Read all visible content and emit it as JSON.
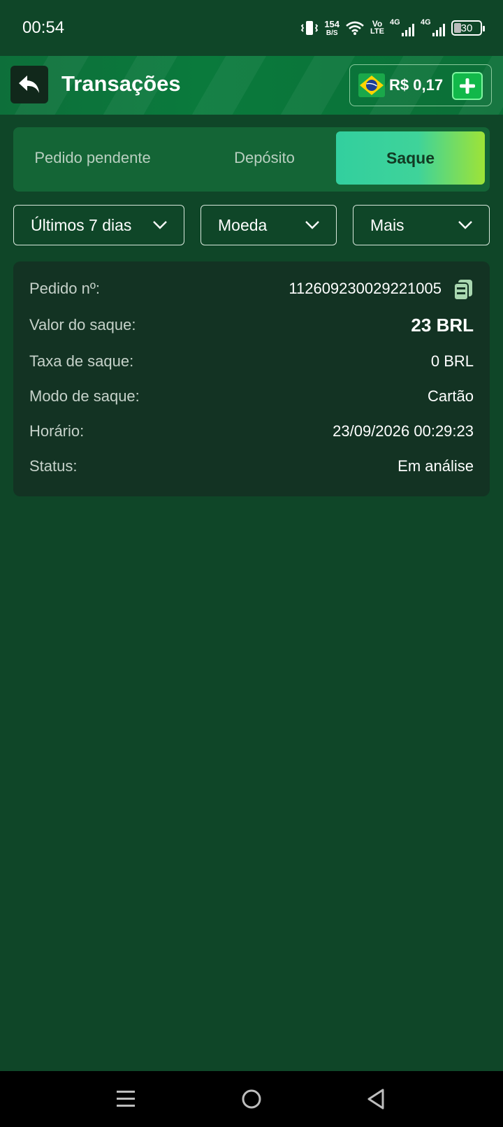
{
  "status_bar": {
    "time": "00:54",
    "net_speed_value": "154",
    "net_speed_unit": "B/S",
    "volte_top": "Vo",
    "volte_bottom": "LTE",
    "signal1_label": "4G",
    "signal2_label": "4G",
    "battery": "30",
    "icons": [
      "vibrate-icon",
      "wifi-icon",
      "signal-icon",
      "signal-icon",
      "battery-icon"
    ]
  },
  "header": {
    "title": "Transações",
    "balance": "R$ 0,17",
    "back_icon": "back-arrow-icon",
    "flag_icon": "brazil-flag-icon",
    "add_icon": "plus-icon",
    "colors": {
      "header_bg": "#0a7a3c",
      "add_button": "#12b84a"
    }
  },
  "tabs": [
    {
      "label": "Pedido pendente",
      "active": false
    },
    {
      "label": "Depósito",
      "active": false
    },
    {
      "label": "Saque",
      "active": true
    }
  ],
  "filters": {
    "period": "Últimos 7 dias",
    "currency": "Moeda",
    "more": "Mais"
  },
  "transaction": {
    "order_label": "Pedido nº:",
    "order_value": "112609230029221005",
    "amount_label": "Valor do saque:",
    "amount_value": "23 BRL",
    "fee_label": "Taxa de saque:",
    "fee_value": "0 BRL",
    "mode_label": "Modo de saque:",
    "mode_value": "Cartão",
    "time_label": "Horário:",
    "time_value": "23/09/2026 00:29:23",
    "status_label": "Status:",
    "status_value": "Em análise"
  },
  "theme": {
    "page_bg": "#0f4628",
    "card_bg": "#133323",
    "tab_active_gradient": [
      "#32cf9e",
      "#9ee337"
    ]
  },
  "nav_bar": {
    "icons": [
      "menu-icon",
      "home-circle-icon",
      "back-triangle-icon"
    ]
  }
}
